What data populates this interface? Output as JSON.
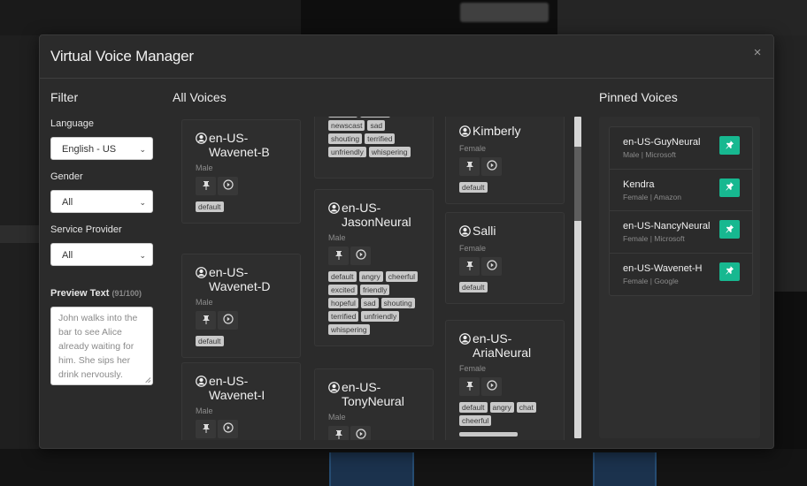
{
  "modal": {
    "title": "Virtual Voice Manager",
    "close_label": "×"
  },
  "filter": {
    "title": "Filter",
    "language_label": "Language",
    "language_value": "English - US",
    "gender_label": "Gender",
    "gender_value": "All",
    "provider_label": "Service Provider",
    "provider_value": "All",
    "preview_label": "Preview Text",
    "preview_count": "(91/100)",
    "preview_text": "John walks into the bar to see Alice already waiting for him. She sips her drink nervously."
  },
  "all_voices": {
    "title": "All Voices",
    "columns": [
      [
        {
          "name": "en-US-Wavenet-B",
          "name_line1": "en-US-",
          "name_line2": "Wavenet-B",
          "gender": "Male",
          "tags": [
            "default"
          ]
        },
        {
          "name": "en-US-Wavenet-D",
          "name_line1": "en-US-",
          "name_line2": "Wavenet-D",
          "gender": "Male",
          "tags": [
            "default"
          ]
        },
        {
          "name": "en-US-Wavenet-I",
          "name_line1": "en-US-",
          "name_line2": "Wavenet-I",
          "gender": "Male",
          "tags": []
        }
      ],
      [
        {
          "name": "",
          "partial": true,
          "tags": [
            "friendly",
            "hopeful",
            "newscast",
            "sad",
            "shouting",
            "terrified",
            "unfriendly",
            "whispering"
          ]
        },
        {
          "name": "en-US-JasonNeural",
          "name_line1": "en-US-",
          "name_line2": "JasonNeural",
          "gender": "Male",
          "tags": [
            "default",
            "angry",
            "cheerful",
            "excited",
            "friendly",
            "hopeful",
            "sad",
            "shouting",
            "terrified",
            "unfriendly",
            "whispering"
          ]
        },
        {
          "name": "en-US-TonyNeural",
          "name_line1": "en-US-",
          "name_line2": "TonyNeural",
          "gender": "Male",
          "tags": []
        }
      ],
      [
        {
          "name": "Kimberly",
          "name_line1": "Kimberly",
          "name_line2": "",
          "gender": "Female",
          "tags": [
            "default"
          ]
        },
        {
          "name": "Salli",
          "name_line1": "Salli",
          "name_line2": "",
          "gender": "Female",
          "tags": [
            "default"
          ]
        },
        {
          "name": "en-US-AriaNeural",
          "name_line1": "en-US-",
          "name_line2": "AriaNeural",
          "gender": "Female",
          "tags": [
            "default",
            "angry",
            "chat",
            "cheerful"
          ]
        }
      ]
    ]
  },
  "pinned": {
    "title": "Pinned Voices",
    "items": [
      {
        "name": "en-US-GuyNeural",
        "meta": "Male | Microsoft"
      },
      {
        "name": "Kendra",
        "meta": "Female | Amazon"
      },
      {
        "name": "en-US-NancyNeural",
        "meta": "Female | Microsoft"
      },
      {
        "name": "en-US-Wavenet-H",
        "meta": "Female | Google"
      }
    ]
  },
  "colors": {
    "accent": "#17b890",
    "modal_bg": "#2b2b2b",
    "tag_bg": "#c9c9c9"
  }
}
